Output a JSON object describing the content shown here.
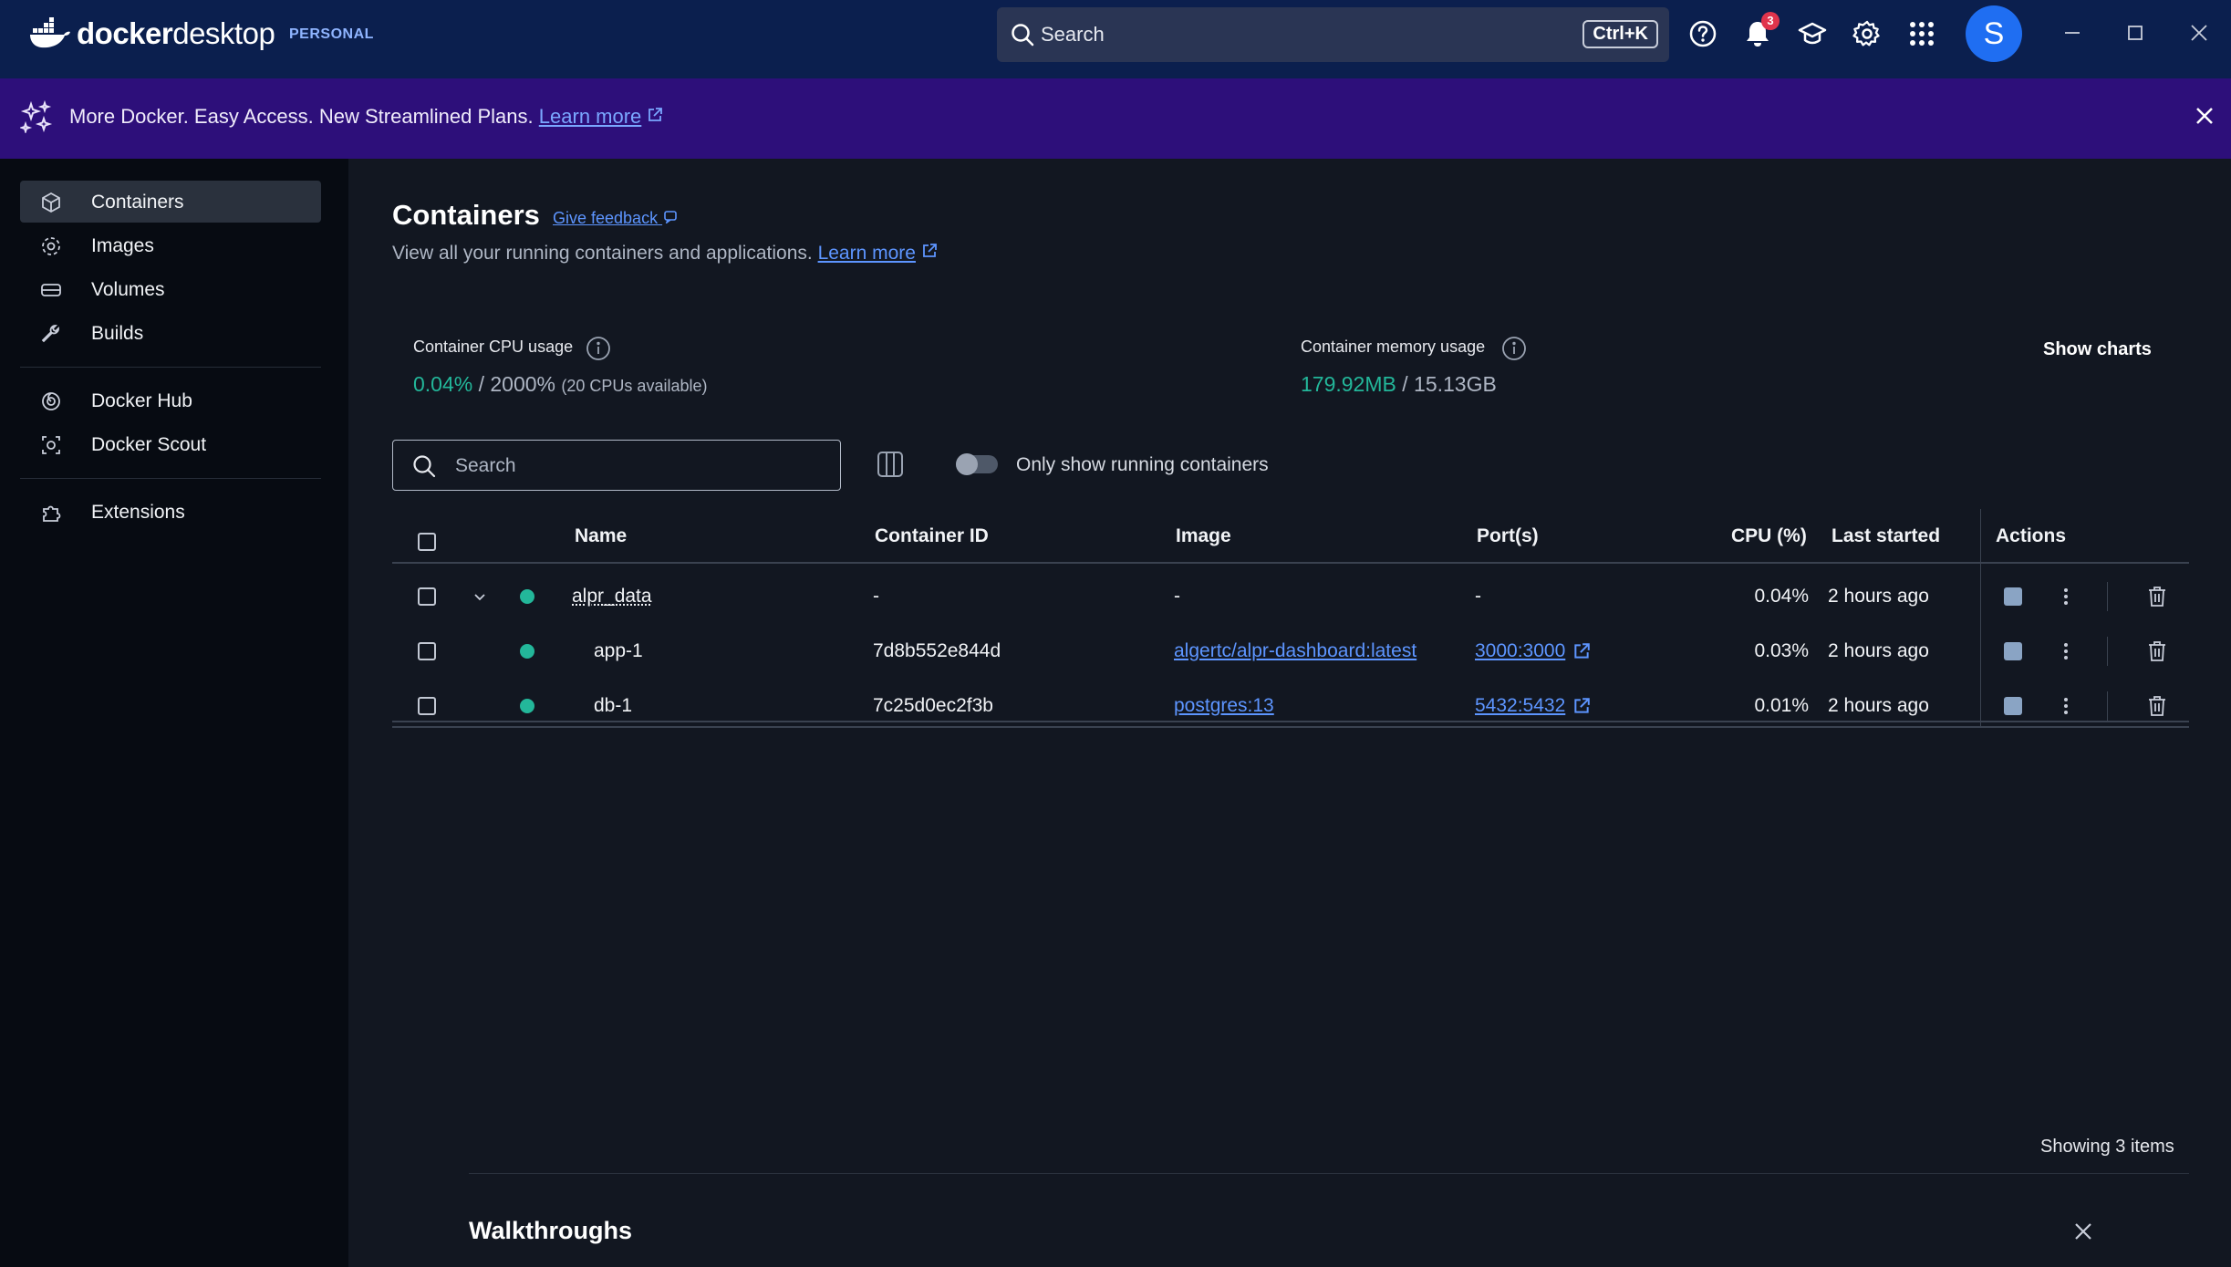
{
  "app": {
    "logo_text_bold": "docker",
    "logo_text_light": "desktop",
    "edition": "PERSONAL",
    "search_label": "Search",
    "search_shortcut": "Ctrl+K",
    "notification_count": "3",
    "avatar_letter": "S"
  },
  "banner": {
    "message": "More Docker. Easy Access. New Streamlined Plans.",
    "link": "Learn more"
  },
  "sidebar": {
    "items": [
      {
        "label": "Containers"
      },
      {
        "label": "Images"
      },
      {
        "label": "Volumes"
      },
      {
        "label": "Builds"
      },
      {
        "label": "Docker Hub"
      },
      {
        "label": "Docker Scout"
      },
      {
        "label": "Extensions"
      }
    ]
  },
  "main": {
    "title": "Containers",
    "feedback": "Give feedback",
    "subtitle": "View all your running containers and applications.",
    "subtitle_link": "Learn more",
    "cpu": {
      "label": "Container CPU usage",
      "used": "0.04%",
      "sep": " / ",
      "total": "2000%",
      "note": "(20 CPUs available)"
    },
    "memory": {
      "label": "Container memory usage",
      "used": "179.92MB",
      "sep": " / ",
      "total": "15.13GB"
    },
    "show_charts": "Show charts",
    "search_placeholder": "Search",
    "toggle_label": "Only show running containers",
    "table": {
      "headers": {
        "name": "Name",
        "container_id": "Container ID",
        "image": "Image",
        "ports": "Port(s)",
        "cpu": "CPU (%)",
        "last_started": "Last started",
        "actions": "Actions"
      },
      "rows": [
        {
          "name": "alpr_data",
          "container_id": "-",
          "image": "-",
          "ports": "-",
          "cpu": "0.04%",
          "last_started": "2 hours ago"
        },
        {
          "name": "app-1",
          "container_id": "7d8b552e844d",
          "image": "algertc/alpr-dashboard:latest",
          "ports": "3000:3000",
          "cpu": "0.03%",
          "last_started": "2 hours ago"
        },
        {
          "name": "db-1",
          "container_id": "7c25d0ec2f3b",
          "image": "postgres:13",
          "ports": "5432:5432",
          "cpu": "0.01%",
          "last_started": "2 hours ago"
        }
      ]
    },
    "showing": "Showing 3 items",
    "walkthroughs": "Walkthroughs"
  },
  "colors": {
    "topbar": "#0b1f4e",
    "banner": "#2d0f7a",
    "running": "#23b79a",
    "link": "#5d95ff"
  }
}
